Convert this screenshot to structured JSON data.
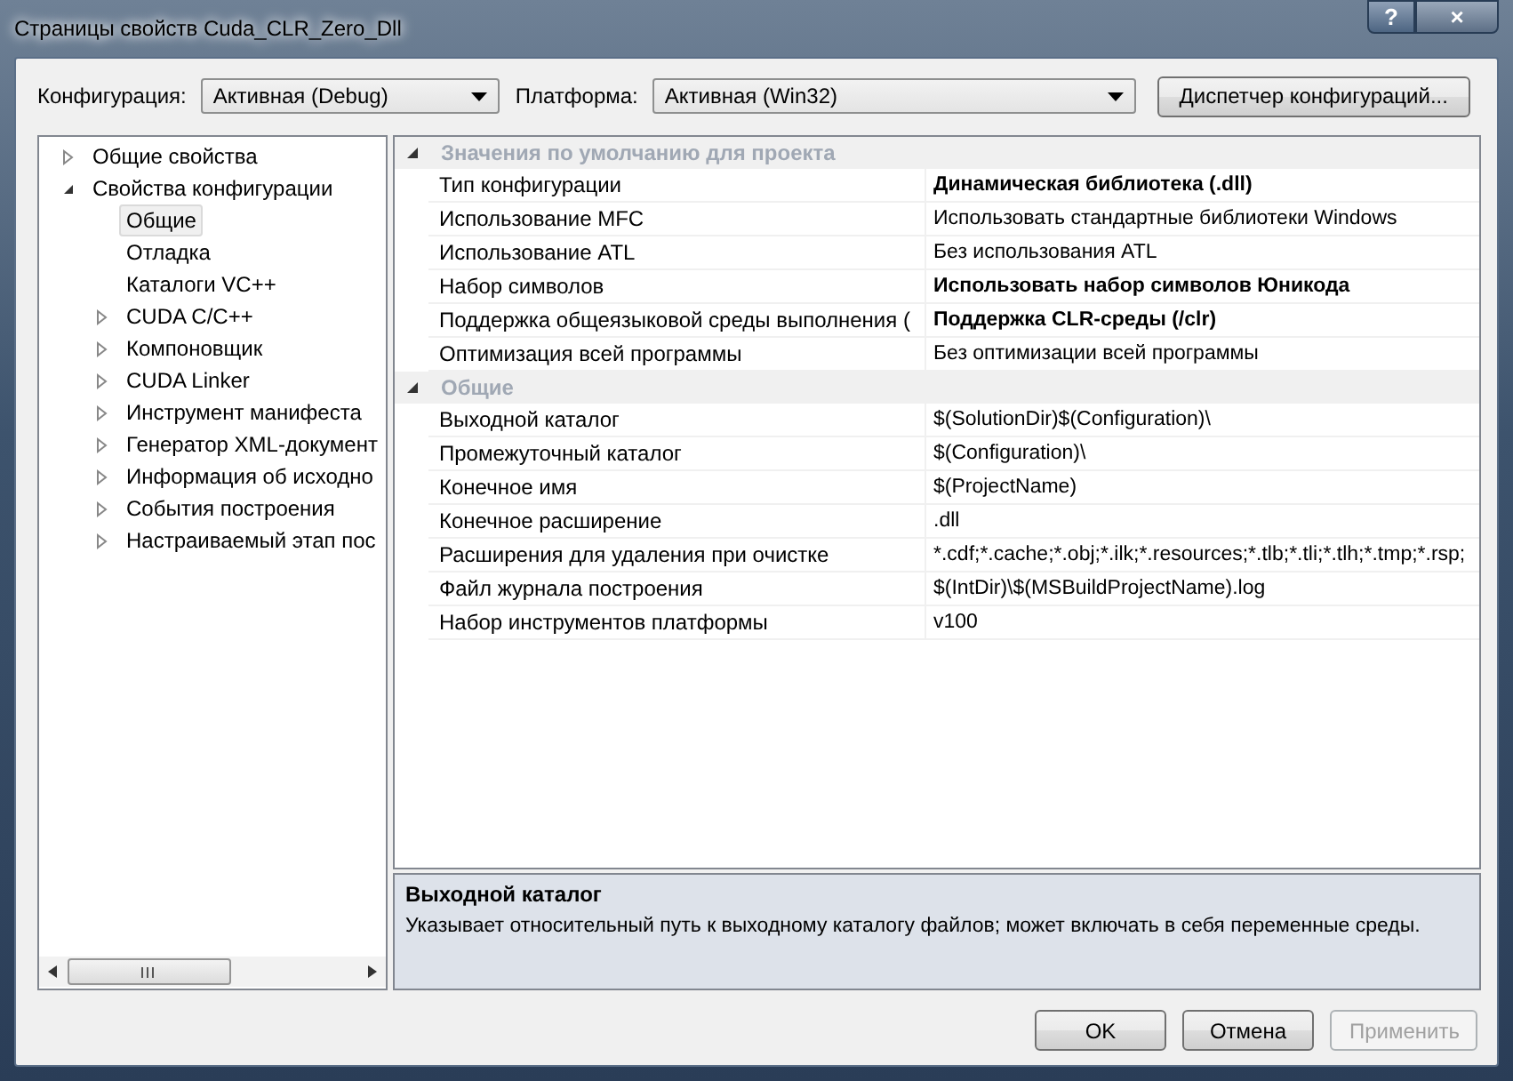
{
  "window": {
    "title": "Страницы свойств Cuda_CLR_Zero_Dll",
    "help": "?",
    "close": "×"
  },
  "toolbar": {
    "configuration_label": "Конфигурация:",
    "configuration_value": "Активная (Debug)",
    "platform_label": "Платформа:",
    "platform_value": "Активная (Win32)",
    "manager_button": "Диспетчер конфигураций..."
  },
  "tree": [
    {
      "label": "Общие свойства",
      "expanded": false,
      "selected": false
    },
    {
      "label": "Свойства конфигурации",
      "expanded": true,
      "selected": false,
      "children": [
        {
          "label": "Общие",
          "kind": "leaf",
          "selected": true
        },
        {
          "label": "Отладка",
          "kind": "leaf",
          "selected": false
        },
        {
          "label": "Каталоги VC++",
          "kind": "leaf",
          "selected": false
        },
        {
          "label": "CUDA C/C++",
          "kind": "folder",
          "selected": false
        },
        {
          "label": "Компоновщик",
          "kind": "folder",
          "selected": false
        },
        {
          "label": "CUDA Linker",
          "kind": "folder",
          "selected": false
        },
        {
          "label": "Инструмент манифеста",
          "kind": "folder",
          "selected": false
        },
        {
          "label": "Генератор XML-документ",
          "kind": "folder",
          "selected": false
        },
        {
          "label": "Информация об исходно",
          "kind": "folder",
          "selected": false
        },
        {
          "label": "События построения",
          "kind": "folder",
          "selected": false
        },
        {
          "label": "Настраиваемый этап пос",
          "kind": "folder",
          "selected": false
        }
      ]
    }
  ],
  "grid": [
    {
      "category": "Значения по умолчанию для проекта",
      "expanded": true,
      "rows": [
        {
          "name": "Тип конфигурации",
          "value": "Динамическая библиотека (.dll)",
          "bold": true
        },
        {
          "name": "Использование MFC",
          "value": "Использовать стандартные библиотеки Windows",
          "bold": false
        },
        {
          "name": "Использование ATL",
          "value": "Без использования ATL",
          "bold": false
        },
        {
          "name": "Набор символов",
          "value": "Использовать набор символов Юникода",
          "bold": true
        },
        {
          "name": "Поддержка общеязыковой среды выполнения (",
          "value": "Поддержка CLR-среды (/clr)",
          "bold": true
        },
        {
          "name": "Оптимизация всей программы",
          "value": "Без оптимизации всей программы",
          "bold": false
        }
      ]
    },
    {
      "category": "Общие",
      "expanded": true,
      "rows": [
        {
          "name": "Выходной каталог",
          "value": "$(SolutionDir)$(Configuration)\\",
          "bold": false
        },
        {
          "name": "Промежуточный каталог",
          "value": "$(Configuration)\\",
          "bold": false
        },
        {
          "name": "Конечное имя",
          "value": "$(ProjectName)",
          "bold": false
        },
        {
          "name": "Конечное расширение",
          "value": ".dll",
          "bold": false
        },
        {
          "name": "Расширения для удаления при очистке",
          "value": "*.cdf;*.cache;*.obj;*.ilk;*.resources;*.tlb;*.tli;*.tlh;*.tmp;*.rsp;",
          "bold": false
        },
        {
          "name": "Файл журнала построения",
          "value": "$(IntDir)\\$(MSBuildProjectName).log",
          "bold": false
        },
        {
          "name": "Набор инструментов платформы",
          "value": "v100",
          "bold": false
        }
      ]
    }
  ],
  "description": {
    "title": "Выходной каталог",
    "text": "Указывает относительный путь к выходному каталогу файлов; может включать в себя  переменные среды."
  },
  "buttons": [
    {
      "label": "OK",
      "disabled": false
    },
    {
      "label": "Отмена",
      "disabled": false
    },
    {
      "label": "Применить",
      "disabled": true
    }
  ]
}
